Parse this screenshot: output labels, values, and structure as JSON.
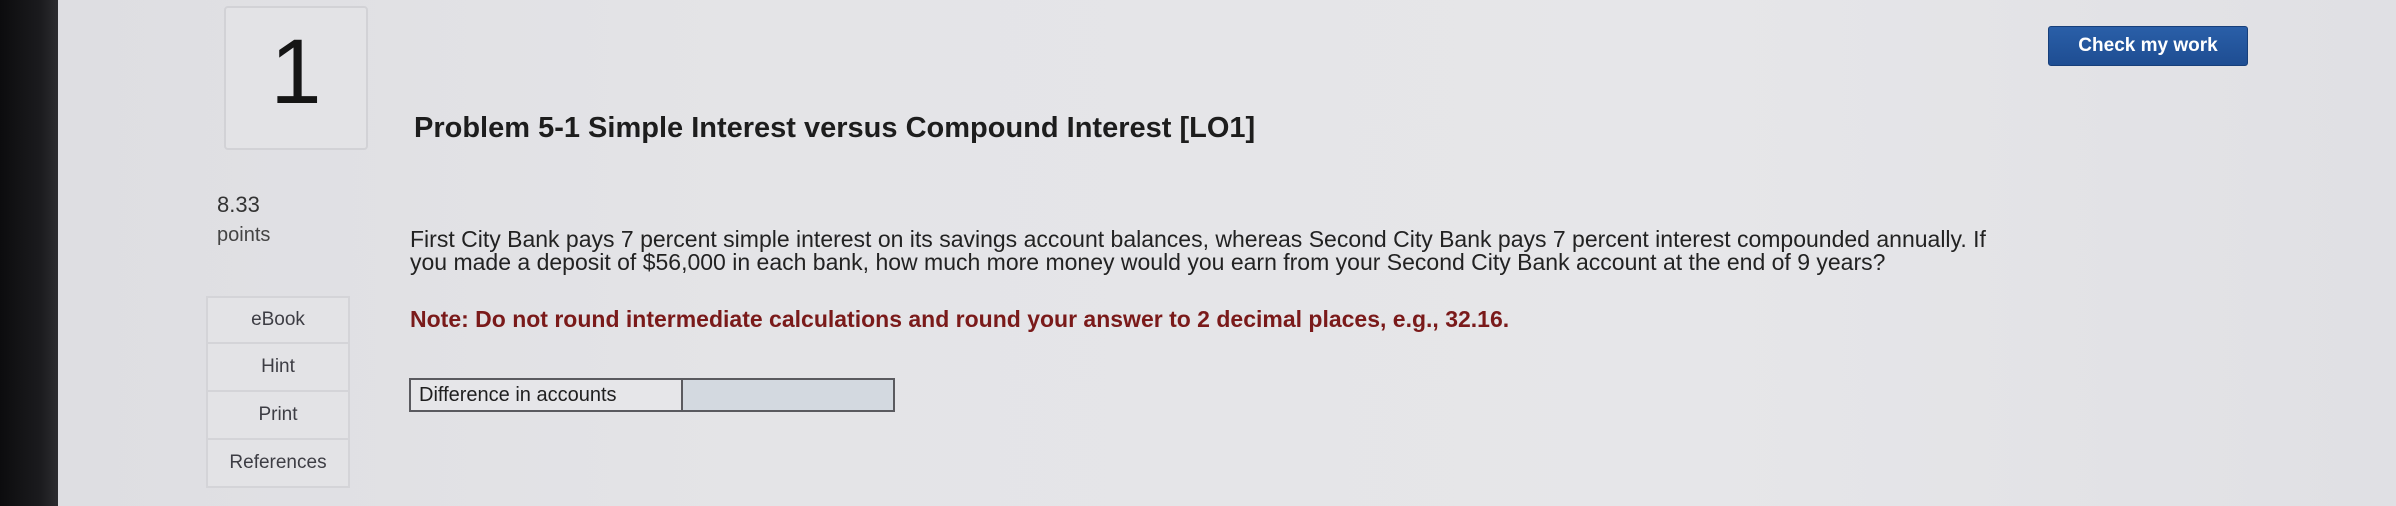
{
  "question": {
    "number": "1",
    "title": "Problem 5-1 Simple Interest versus Compound Interest [LO1]",
    "points_value": "8.33",
    "points_label": "points",
    "body": "First City Bank pays 7 percent simple interest on its savings account balances, whereas Second City Bank pays 7 percent interest compounded annually. If you made a deposit of $56,000 in each bank, how much more money would you earn from your Second City Bank account at the end of 9 years?",
    "note": "Note: Do not round intermediate calculations and round your answer to 2 decimal places, e.g., 32.16."
  },
  "side_menu": {
    "items": [
      {
        "label": "eBook"
      },
      {
        "label": "Hint"
      },
      {
        "label": "Print"
      },
      {
        "label": "References"
      }
    ]
  },
  "answer": {
    "label": "Difference in accounts",
    "value": ""
  },
  "toolbar": {
    "check_label": "Check my work"
  },
  "colors": {
    "accent_button": "#1e4d92",
    "note_text": "#7a1a1a",
    "input_bg": "#d3d9e0"
  }
}
